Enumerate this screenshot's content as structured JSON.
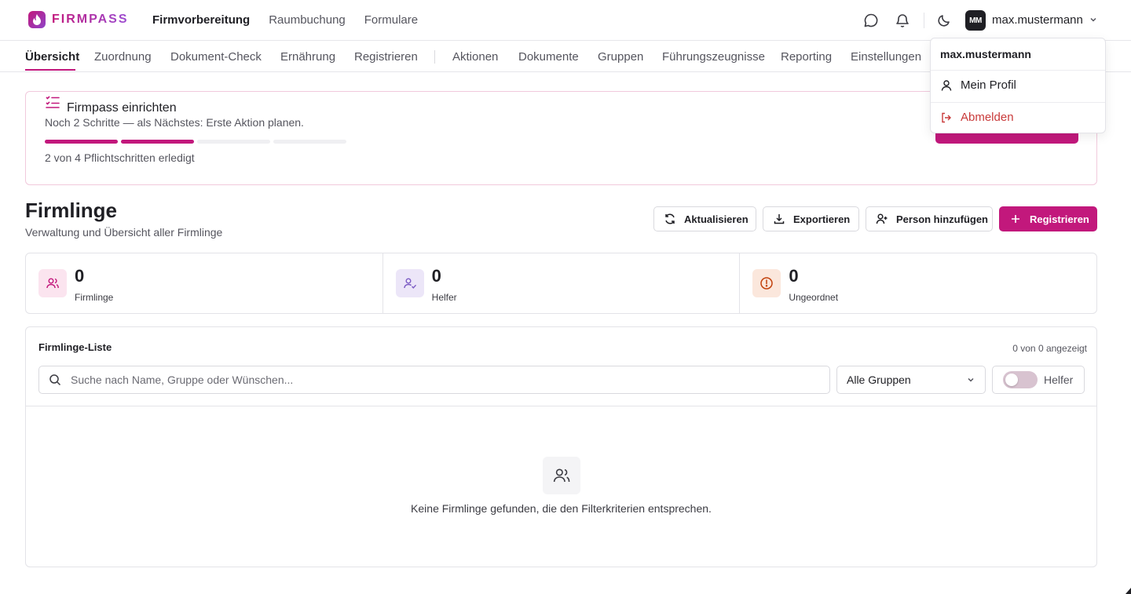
{
  "app": {
    "name": "FIRMPASS"
  },
  "main_nav": [
    "Firmvorbereitung",
    "Raumbuchung",
    "Formulare"
  ],
  "user": {
    "initials": "MM",
    "name": "max.mustermann"
  },
  "sub_nav": [
    "Übersicht",
    "Zuordnung",
    "Dokument-Check",
    "Ernährung",
    "Registrieren",
    "Aktionen",
    "Dokumente",
    "Gruppen",
    "Führungszeugnisse",
    "Reporting",
    "Einstellungen"
  ],
  "setup": {
    "title": "Firmpass einrichten",
    "subtitle": "Noch 2 Schritte — als Nächstes: Erste Aktion planen.",
    "progress_done": 2,
    "progress_total": 4,
    "footer": "2 von 4 Pflichtschritten erledigt"
  },
  "header": {
    "title": "Firmlinge",
    "subtitle": "Verwaltung und Übersicht aller Firmlinge",
    "actions": {
      "refresh": "Aktualisieren",
      "export": "Exportieren",
      "add_person": "Person hinzufügen",
      "register": "Registrieren"
    }
  },
  "stats": [
    {
      "value": "0",
      "label": "Firmlinge",
      "icon": "users-icon",
      "color": "#c2187c",
      "bg": "#fbe4ef"
    },
    {
      "value": "0",
      "label": "Helfer",
      "icon": "user-check-icon",
      "color": "#7c5cc4",
      "bg": "#ece6f8"
    },
    {
      "value": "0",
      "label": "Ungeordnet",
      "icon": "alert-circle-icon",
      "color": "#c2410c",
      "bg": "#fbe7dc"
    }
  ],
  "list": {
    "title": "Firmlinge-Liste",
    "count": "0 von 0 angezeigt",
    "search_placeholder": "Suche nach Name, Gruppe oder Wünschen...",
    "group_select": "Alle Gruppen",
    "helper_toggle": "Helfer",
    "empty": "Keine Firmlinge gefunden, die den Filterkriterien entsprechen."
  },
  "dropdown": {
    "username": "max.mustermann",
    "profile": "Mein Profil",
    "logout": "Abmelden"
  },
  "colors": {
    "accent": "#c2187c",
    "danger": "#c93a3a"
  }
}
